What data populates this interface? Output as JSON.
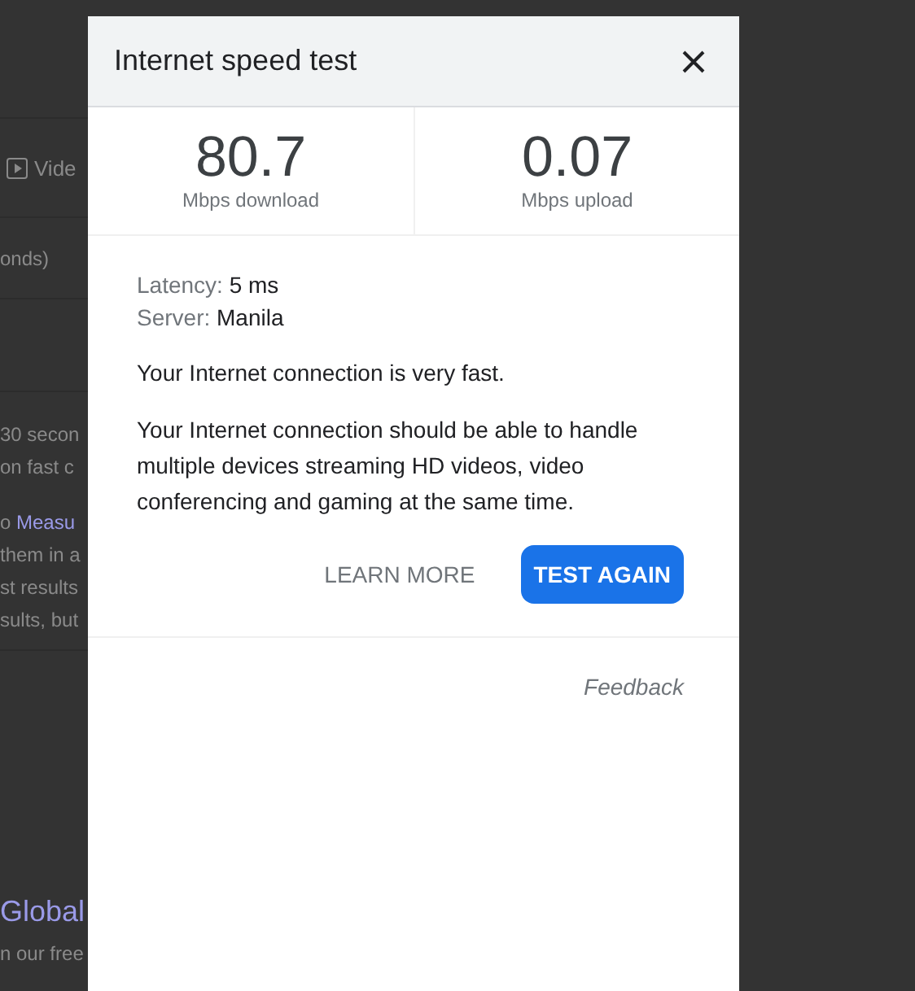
{
  "background": {
    "tab": {
      "text": "Vide"
    },
    "caption": "onds)",
    "paragraph_1": [
      "30 secon",
      "on fast c"
    ],
    "paragraph_2": [
      {
        "before": "o ",
        "link": "Measu"
      },
      {
        "before": "them in a"
      },
      {
        "before": "st results"
      },
      {
        "before": "sults, but"
      }
    ],
    "heading": "Global",
    "subtext": "n our free"
  },
  "dialog": {
    "title": "Internet speed test",
    "stats": [
      {
        "value": "80.7",
        "unit": "Mbps download"
      },
      {
        "value": "0.07",
        "unit": "Mbps upload"
      }
    ],
    "details": [
      {
        "label": "Latency:",
        "value": "5 ms"
      },
      {
        "label": "Server:",
        "value": "Manila"
      }
    ],
    "summary": "Your Internet connection is very fast.",
    "description": "Your Internet connection should be able to handle multiple devices streaming HD videos, video conferencing and gaming at the same time.",
    "buttons": [
      {
        "label": "LEARN MORE",
        "kind": "text"
      },
      {
        "label": "TEST AGAIN",
        "kind": "primary"
      }
    ],
    "feedback": "Feedback"
  }
}
